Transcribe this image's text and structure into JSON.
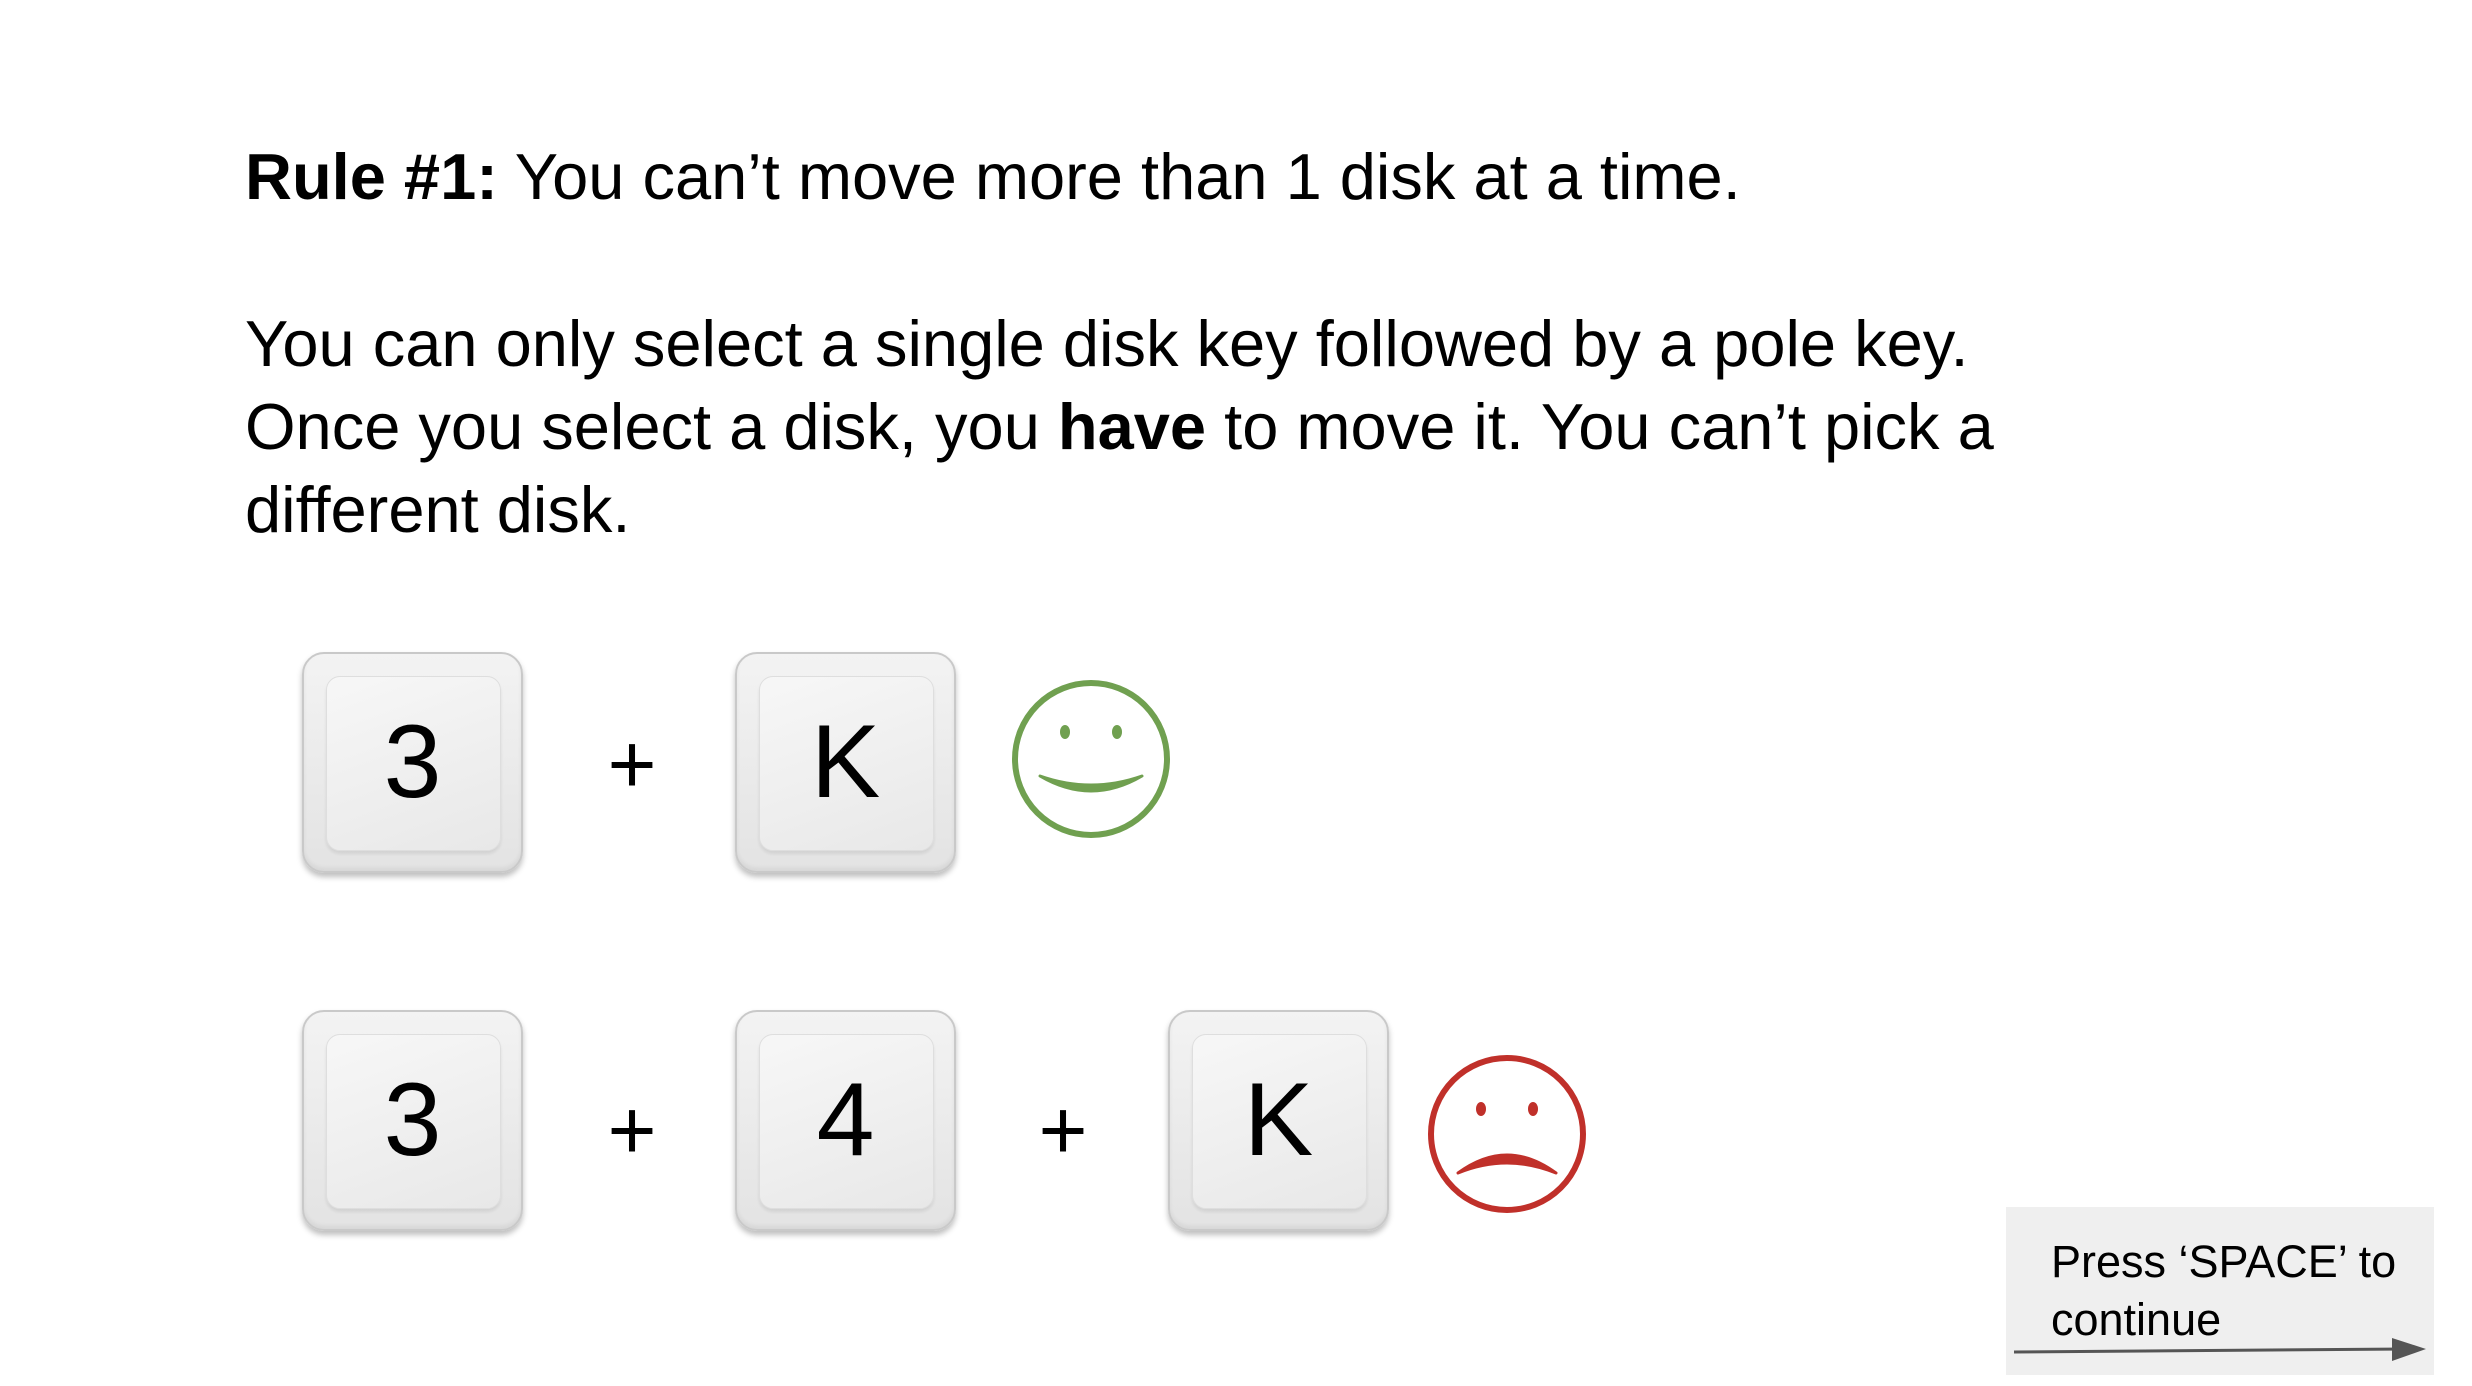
{
  "rule": {
    "heading": "Rule #1:",
    "text": " You can’t move more than 1 disk at a time."
  },
  "paragraph": {
    "line1": "You can only select a single disk key followed by a pole key.",
    "line2_before": "Once you select a disk, you ",
    "line2_bold": "have",
    "line2_after": " to move it. You can’t pick a",
    "line3": "different disk."
  },
  "example_valid": {
    "keys": [
      "3",
      "K"
    ],
    "operator": "+",
    "result_icon": "smiley-face-icon",
    "color": "#70a050"
  },
  "example_invalid": {
    "keys": [
      "3",
      "4",
      "K"
    ],
    "operator": "+",
    "result_icon": "frowning-face-icon",
    "color": "#c0302a"
  },
  "continue_prompt": {
    "text": "Press ‘SPACE’ to\ncontinue",
    "icon": "arrow-right-icon"
  }
}
